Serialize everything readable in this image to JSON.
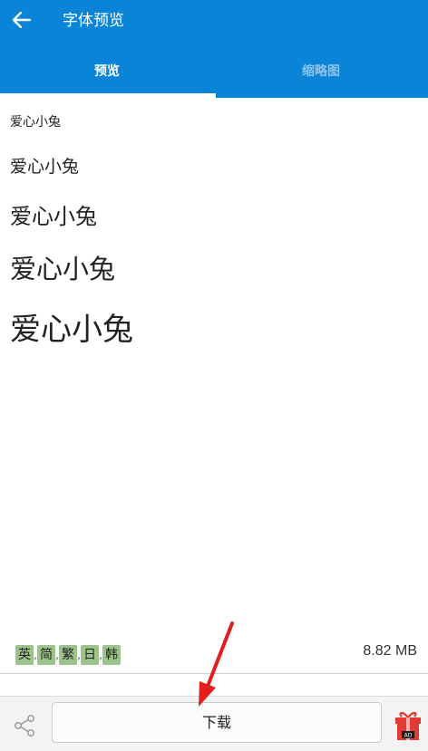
{
  "header": {
    "title": "字体预览",
    "back_icon": "arrow-left-icon"
  },
  "tabs": [
    {
      "label": "预览",
      "active": true
    },
    {
      "label": "缩略图",
      "active": false
    }
  ],
  "previews": [
    "爱心小兔",
    "爱心小兔",
    "爱心小兔",
    "爱心小兔",
    "爱心小兔"
  ],
  "languages": [
    "英",
    "简",
    "繁",
    "日",
    "韩"
  ],
  "file_size": "8.82 MB",
  "bottom": {
    "share_icon": "share-icon",
    "download_label": "下载",
    "gift_icon": "gift-icon",
    "gift_badge": "AD"
  },
  "colors": {
    "appbar": "#0a84d6",
    "tab_inactive": "#8dc4ee",
    "lang_tag": "#9cc48a",
    "gift": "#e23b33",
    "annotation_arrow": "#e31e1e"
  }
}
